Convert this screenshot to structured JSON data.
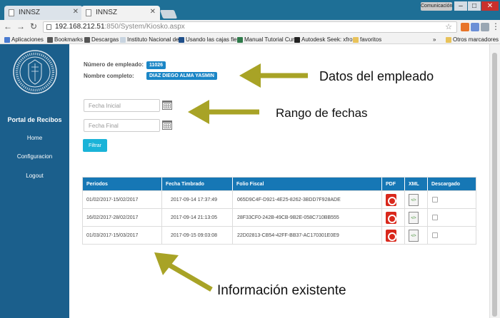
{
  "browser": {
    "tabs": [
      {
        "label": "INNSZ",
        "active": false
      },
      {
        "label": "INNSZ",
        "active": true
      }
    ],
    "user_badge": "Comunicación",
    "url_host": "192.168.212.51",
    "url_path": ":850/System/Kiosko.aspx",
    "bookmarks": [
      {
        "label": "Aplicaciones",
        "icon": "apps-icon"
      },
      {
        "label": "Bookmarks",
        "icon": "star-icon"
      },
      {
        "label": "Descargas",
        "icon": "download-icon"
      },
      {
        "label": "Instituto Nacional de",
        "icon": "page-icon"
      },
      {
        "label": "Usando las cajas flex",
        "icon": "page-icon"
      },
      {
        "label": "Manual Tutorial Curs",
        "icon": "page-icon"
      },
      {
        "label": "Autodesk Seek: xfrog",
        "icon": "page-icon"
      },
      {
        "label": "favoritos",
        "icon": "folder-icon"
      },
      {
        "label": "Otros marcadores",
        "icon": "folder-icon"
      }
    ],
    "overflow_chevron": "»"
  },
  "sidebar": {
    "portal_title": "Portal de Recibos",
    "nav": [
      "Home",
      "Configuracion",
      "Logout"
    ]
  },
  "employee": {
    "number_label": "Número de empleado:",
    "number_value": "11026",
    "name_label": "Nombre completo:",
    "name_value": "DIAZ DIEGO ALMA YASMIN"
  },
  "filters": {
    "start_placeholder": "Fecha Inicial",
    "end_placeholder": "Fecha Final",
    "filter_label": "Filtrar"
  },
  "table": {
    "headers": [
      "Periodos",
      "Fecha Timbrado",
      "Folio Fiscal",
      "PDF",
      "XML",
      "Descargado"
    ],
    "rows": [
      {
        "period": "01/02/2017-15/02/2017",
        "stamp": "2017-09-14 17:37:49",
        "folio": "065D9C4F-D921-4E25-8262-3BDD7F928ADE",
        "downloaded": false
      },
      {
        "period": "16/02/2017-28/02/2017",
        "stamp": "2017-09-14 21:13:05",
        "folio": "28F33CF0-242B-49CB-9B2E-058C710BB555",
        "downloaded": false
      },
      {
        "period": "01/03/2017-15/03/2017",
        "stamp": "2017-09-15 09:03:08",
        "folio": "22D02813-CB54-42FF-BB37-AC170301E0E9",
        "downloaded": false
      }
    ]
  },
  "annotations": {
    "employee": "Datos del empleado",
    "dates": "Rango de fechas",
    "info": "Información existente",
    "arrow_color": "#a8a326"
  }
}
